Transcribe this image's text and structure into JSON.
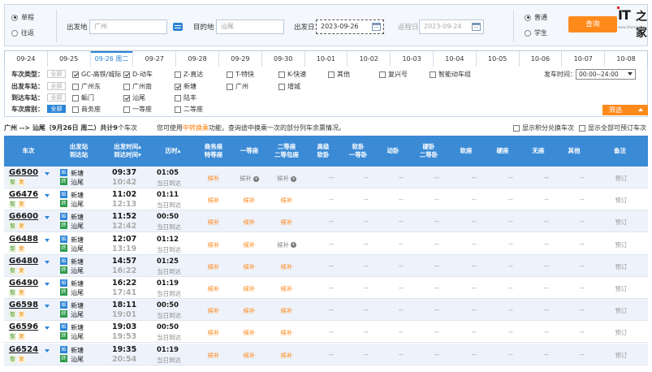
{
  "search": {
    "trip_type": [
      {
        "label": "单程",
        "selected": true
      },
      {
        "label": "往返",
        "selected": false
      }
    ],
    "from_label": "出发地",
    "from_value": "广州",
    "to_label": "目的地",
    "to_value": "汕尾",
    "depart_label": "出发日",
    "depart_value": "2023-09-26",
    "return_label": "返程日",
    "return_value": "2023-09-24",
    "passenger_type": [
      {
        "label": "普通",
        "selected": true
      },
      {
        "label": "学生",
        "selected": false
      }
    ],
    "query_label": "查询"
  },
  "logo": {
    "brand": "IT",
    "brand_zh": "之家",
    "url": "www.ithome.com"
  },
  "date_tabs": [
    {
      "label": "09-24",
      "active": false
    },
    {
      "label": "09-25",
      "active": false
    },
    {
      "label": "09-26 周二",
      "active": true
    },
    {
      "label": "09-27",
      "active": false
    },
    {
      "label": "09-28",
      "active": false
    },
    {
      "label": "09-29",
      "active": false
    },
    {
      "label": "09-30",
      "active": false
    },
    {
      "label": "10-01",
      "active": false
    },
    {
      "label": "10-02",
      "active": false
    },
    {
      "label": "10-03",
      "active": false
    },
    {
      "label": "10-04",
      "active": false
    },
    {
      "label": "10-05",
      "active": false
    },
    {
      "label": "10-06",
      "active": false
    },
    {
      "label": "10-07",
      "active": false
    },
    {
      "label": "10-08",
      "active": false
    }
  ],
  "filters": {
    "all_label": "全部",
    "train_type": {
      "label": "车次类型：",
      "all_on": false,
      "options": [
        {
          "label": "GC-高铁/城际",
          "checked": true
        },
        {
          "label": "D-动车",
          "checked": true
        },
        {
          "label": "Z-直达",
          "checked": false
        },
        {
          "label": "T-特快",
          "checked": false
        },
        {
          "label": "K-快速",
          "checked": false
        },
        {
          "label": "其他",
          "checked": false
        },
        {
          "label": "复兴号",
          "checked": false
        },
        {
          "label": "智能动车组",
          "checked": false
        }
      ]
    },
    "depart_station": {
      "label": "出发车站：",
      "all_on": false,
      "options": [
        {
          "label": "广州东",
          "checked": false
        },
        {
          "label": "广州南",
          "checked": false
        },
        {
          "label": "新塘",
          "checked": true
        },
        {
          "label": "广州",
          "checked": false
        },
        {
          "label": "增城",
          "checked": false
        }
      ]
    },
    "arrive_station": {
      "label": "到达车站：",
      "all_on": false,
      "options": [
        {
          "label": "鲘门",
          "checked": false
        },
        {
          "label": "汕尾",
          "checked": true
        },
        {
          "label": "陆丰",
          "checked": false
        }
      ]
    },
    "seat_type": {
      "label": "车次席别：",
      "all_on": true,
      "options": [
        {
          "label": "商务座",
          "checked": false
        },
        {
          "label": "一等座",
          "checked": false
        },
        {
          "label": "二等座",
          "checked": false
        }
      ]
    },
    "depart_time_label": "发车时间：",
    "depart_time_value": "00:00--24:00",
    "filter_btn_label": "筛选"
  },
  "summary": {
    "route": "广州 --> 汕尾（9月26日  周二）共计",
    "count": "9",
    "count_suffix": "个车次",
    "tip_prefix": "您可使用",
    "tip_highlight": "中转换乘",
    "tip_suffix": "功能，查询途中换乘一次的部分列车余票情况。",
    "opt_points": "显示积分兑换车次",
    "opt_all": "显示全部可预订车次"
  },
  "table_headers": [
    {
      "l1": "车次",
      "l2": ""
    },
    {
      "l1": "出发站",
      "l2": "到达站"
    },
    {
      "l1": "出发时间▴",
      "l2": "到达时间▾"
    },
    {
      "l1": "历时▴",
      "l2": ""
    },
    {
      "l1": "商务座",
      "l2": "特等座"
    },
    {
      "l1": "一等座",
      "l2": ""
    },
    {
      "l1": "二等座",
      "l2": "二等包座"
    },
    {
      "l1": "高级",
      "l2": "软卧"
    },
    {
      "l1": "软卧",
      "l2": "一等卧"
    },
    {
      "l1": "动卧",
      "l2": ""
    },
    {
      "l1": "硬卧",
      "l2": "二等卧"
    },
    {
      "l1": "软座",
      "l2": ""
    },
    {
      "l1": "硬座",
      "l2": ""
    },
    {
      "l1": "无座",
      "l2": ""
    },
    {
      "l1": "其他",
      "l2": ""
    },
    {
      "l1": "备注",
      "l2": ""
    }
  ],
  "labels": {
    "badge_zhi": "智",
    "badge_fu": "复",
    "start_icon": "始",
    "end_icon": "终",
    "same_day": "当日到达",
    "book": "预订",
    "dash": "--"
  },
  "trains": [
    {
      "no": "G6500",
      "from": "新塘",
      "to": "汕尾",
      "dep": "09:37",
      "arr": "10:42",
      "dur": "01:05",
      "business": "候补",
      "first": "候补",
      "second": "候补",
      "first_plus": true,
      "second_plus": true,
      "b_orange": true,
      "f_orange": false,
      "s_orange": false
    },
    {
      "no": "G6476",
      "from": "新塘",
      "to": "汕尾",
      "dep": "11:02",
      "arr": "12:13",
      "dur": "01:11",
      "business": "候补",
      "first": "候补",
      "second": "候补",
      "first_plus": false,
      "second_plus": false,
      "b_orange": true,
      "f_orange": true,
      "s_orange": true
    },
    {
      "no": "G6600",
      "from": "新塘",
      "to": "汕尾",
      "dep": "11:52",
      "arr": "12:42",
      "dur": "00:50",
      "business": "候补",
      "first": "候补",
      "second": "候补",
      "first_plus": false,
      "second_plus": false,
      "b_orange": true,
      "f_orange": true,
      "s_orange": true
    },
    {
      "no": "G6488",
      "from": "新塘",
      "to": "汕尾",
      "dep": "12:07",
      "arr": "13:19",
      "dur": "01:12",
      "business": "候补",
      "first": "候补",
      "second": "候补",
      "first_plus": false,
      "second_plus": true,
      "b_orange": true,
      "f_orange": true,
      "s_orange": false
    },
    {
      "no": "G6480",
      "from": "新塘",
      "to": "汕尾",
      "dep": "14:57",
      "arr": "16:22",
      "dur": "01:25",
      "business": "候补",
      "first": "候补",
      "second": "候补",
      "first_plus": false,
      "second_plus": false,
      "b_orange": true,
      "f_orange": true,
      "s_orange": true
    },
    {
      "no": "G6490",
      "from": "新塘",
      "to": "汕尾",
      "dep": "16:22",
      "arr": "17:41",
      "dur": "01:19",
      "business": "候补",
      "first": "候补",
      "second": "候补",
      "first_plus": false,
      "second_plus": false,
      "b_orange": true,
      "f_orange": true,
      "s_orange": true
    },
    {
      "no": "G6598",
      "from": "新塘",
      "to": "汕尾",
      "dep": "18:11",
      "arr": "19:01",
      "dur": "00:50",
      "business": "候补",
      "first": "候补",
      "second": "候补",
      "first_plus": false,
      "second_plus": false,
      "b_orange": true,
      "f_orange": true,
      "s_orange": true
    },
    {
      "no": "G6596",
      "from": "新塘",
      "to": "汕尾",
      "dep": "19:03",
      "arr": "19:53",
      "dur": "00:50",
      "business": "候补",
      "first": "候补",
      "second": "候补",
      "first_plus": false,
      "second_plus": false,
      "b_orange": true,
      "f_orange": true,
      "s_orange": true
    },
    {
      "no": "G6524",
      "from": "新塘",
      "to": "汕尾",
      "dep": "19:35",
      "arr": "20:54",
      "dur": "01:19",
      "business": "候补",
      "first": "候补",
      "second": "候补",
      "first_plus": false,
      "second_plus": false,
      "b_orange": true,
      "f_orange": true,
      "s_orange": true
    }
  ],
  "colors": {
    "accent_blue": "#3a8ad6",
    "accent_orange": "#ff8a1c",
    "row_alt": "#eef3fb"
  }
}
